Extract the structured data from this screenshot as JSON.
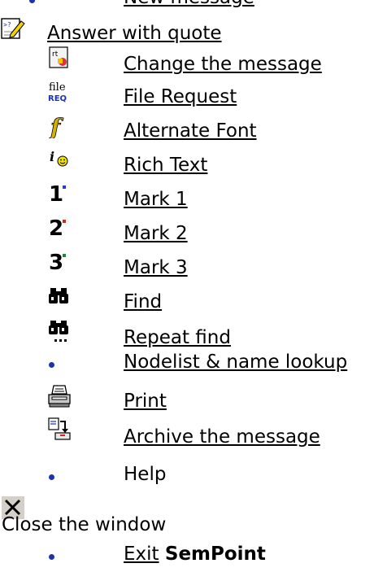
{
  "items": {
    "new_message": "New message",
    "answer_with_quote": "Answer with quote",
    "change_message": "Change the message",
    "file_request": "File Request",
    "alternate_font": "Alternate Font",
    "rich_text": "Rich Text",
    "mark1": "Mark 1",
    "mark2": "Mark 2",
    "mark3": "Mark 3",
    "find": "Find",
    "repeat_find": "Repeat find",
    "nodelist": "Nodelist & name lookup",
    "print": "Print",
    "archive": "Archive the message",
    "help": "Help",
    "close_window": "Close the window",
    "exit_word": "Exit",
    "exit_app": "SemPoint"
  },
  "icon_text": {
    "rt": "rt",
    "file": "file",
    "req": "REQ",
    "f": "f",
    "i": "i",
    "n1": "1",
    "n2": "2",
    "n3": "3"
  },
  "icons": {
    "answer": "edit-quote-icon",
    "change": "change-message-icon",
    "file_request": "file-request-icon",
    "font": "alternate-font-icon",
    "rich": "rich-text-icon",
    "mark1": "mark-1-icon",
    "mark2": "mark-2-icon",
    "mark3": "mark-3-icon",
    "find": "binoculars-icon",
    "repeat": "binoculars-repeat-icon",
    "print": "printer-icon",
    "archive": "archive-icon",
    "close": "close-x-icon"
  },
  "colors": {
    "bullet": "#1c33b0",
    "mark1": "#1e3fe0",
    "mark2": "#e02020",
    "mark3": "#1a8a2a"
  }
}
